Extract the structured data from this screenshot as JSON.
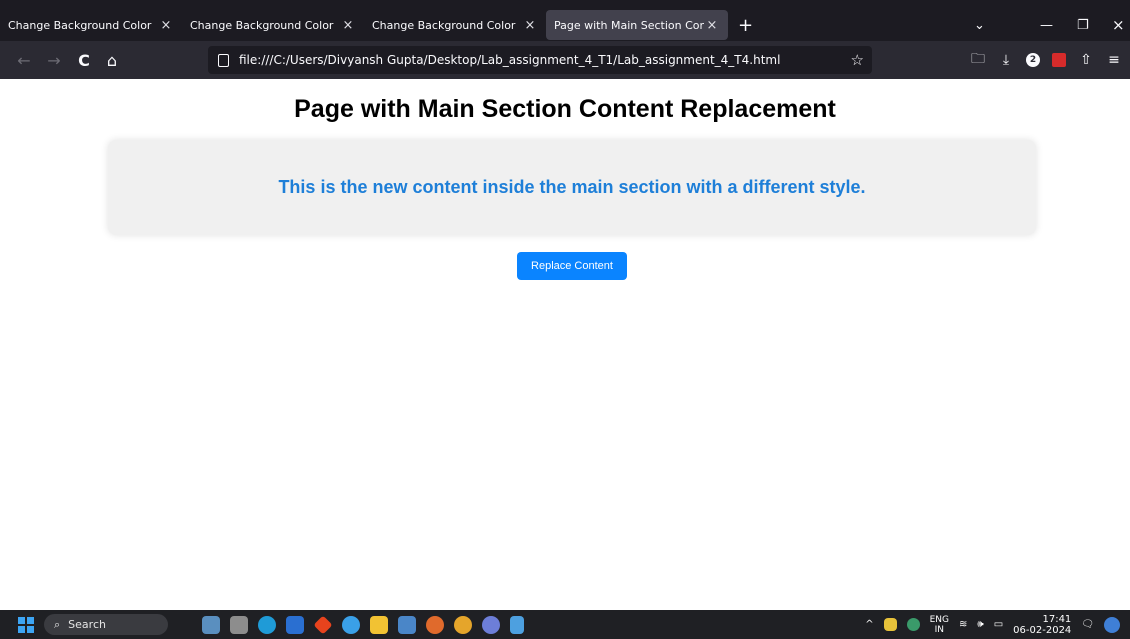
{
  "tabs": [
    {
      "title": "Change Background Color",
      "close": "×"
    },
    {
      "title": "Change Background Color",
      "close": "×"
    },
    {
      "title": "Change Background Color",
      "close": "×"
    },
    {
      "title": "Page with Main Section Content Rep",
      "close": "×"
    }
  ],
  "new_tab": "+",
  "window_controls": {
    "list": "⌄",
    "minimize": "—",
    "restore": "❐",
    "close": "×"
  },
  "nav": {
    "back": "←",
    "forward": "→",
    "reload": "C",
    "home": "⌂"
  },
  "url": "file:///C:/Users/Divyansh Gupta/Desktop/Lab_assignment_4_T1/Lab_assignment_4_T4.html",
  "url_star": "☆",
  "toolbar": {
    "save": "🗀",
    "download": "⤓",
    "badge_count": "2",
    "share": "⇧",
    "menu": "≡"
  },
  "page": {
    "heading": "Page with Main Section Content Replacement",
    "main_text": "This is the new content inside the main section with a different style.",
    "button": "Replace Content"
  },
  "taskbar": {
    "search": "Search",
    "lang_top": "ENG",
    "lang_bottom": "IN",
    "time": "17:41",
    "date": "06-02-2024",
    "tray_chevron": "^",
    "volume": "🕪"
  }
}
